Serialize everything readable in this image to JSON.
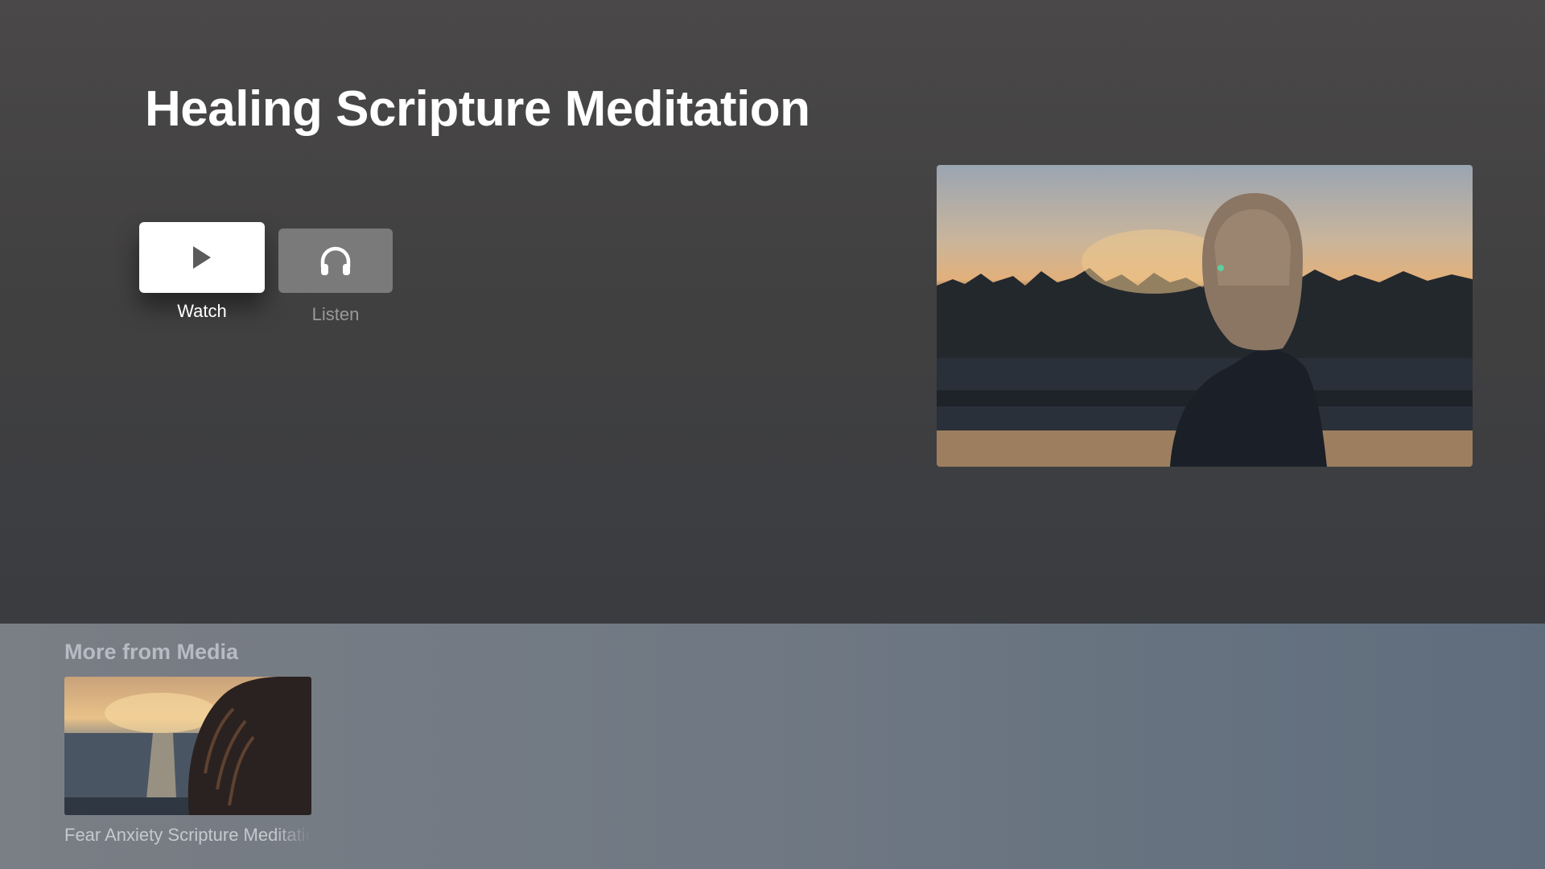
{
  "page": {
    "title": "Healing Scripture Meditation"
  },
  "actions": {
    "watch": {
      "label": "Watch",
      "icon": "play-icon"
    },
    "listen": {
      "label": "Listen",
      "icon": "headphones-icon"
    }
  },
  "hero": {
    "image": "woman-by-lake-at-sunset"
  },
  "more": {
    "section_title": "More from Media",
    "items": [
      {
        "caption": "Fear Anxiety Scripture Meditation",
        "image": "woman-hair-ocean-sunset"
      }
    ]
  },
  "colors": {
    "background_top": "#4a4849",
    "shelf": "#6f7883",
    "button_active": "#ffffff",
    "button_inactive": "#7b7a7b"
  }
}
